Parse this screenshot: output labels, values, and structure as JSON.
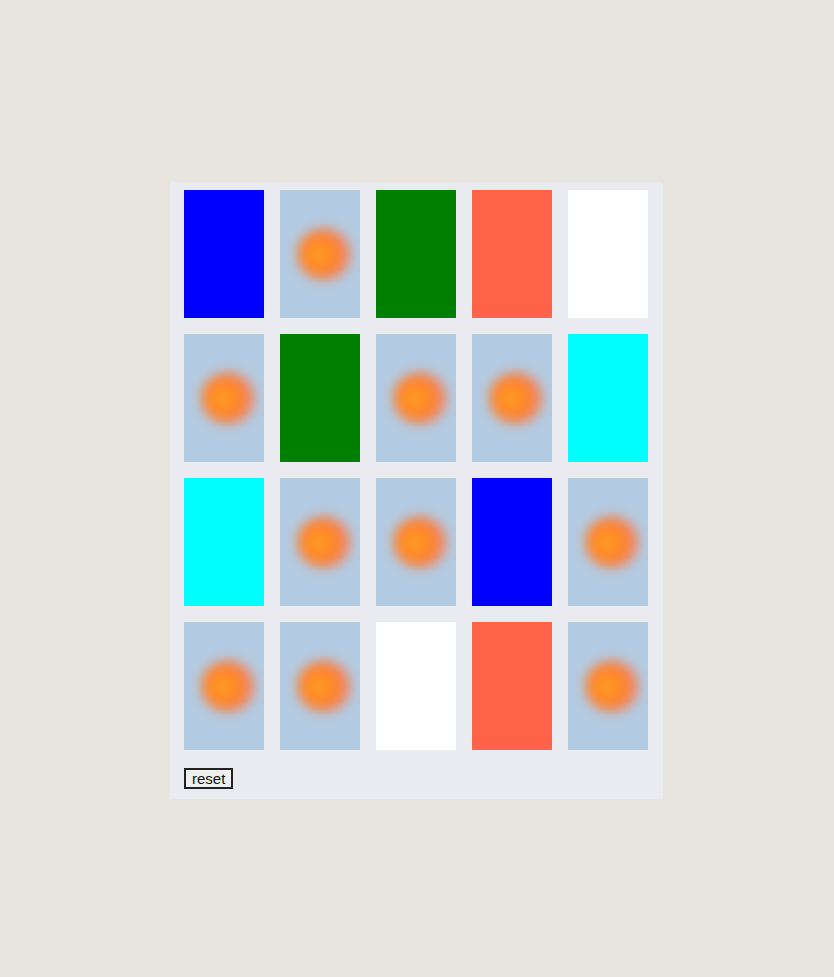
{
  "cards": [
    {
      "face_up": true,
      "color": "#0000ff"
    },
    {
      "face_up": false
    },
    {
      "face_up": true,
      "color": "#008000"
    },
    {
      "face_up": true,
      "color": "#ff6347"
    },
    {
      "face_up": true,
      "color": "#ffffff"
    },
    {
      "face_up": false
    },
    {
      "face_up": true,
      "color": "#008000"
    },
    {
      "face_up": false
    },
    {
      "face_up": false
    },
    {
      "face_up": true,
      "color": "#00ffff"
    },
    {
      "face_up": true,
      "color": "#00ffff"
    },
    {
      "face_up": false
    },
    {
      "face_up": false
    },
    {
      "face_up": true,
      "color": "#0000ff"
    },
    {
      "face_up": false
    },
    {
      "face_up": false
    },
    {
      "face_up": false
    },
    {
      "face_up": true,
      "color": "#ffffff"
    },
    {
      "face_up": true,
      "color": "#ff6347"
    },
    {
      "face_up": false
    }
  ],
  "reset_button": "reset"
}
